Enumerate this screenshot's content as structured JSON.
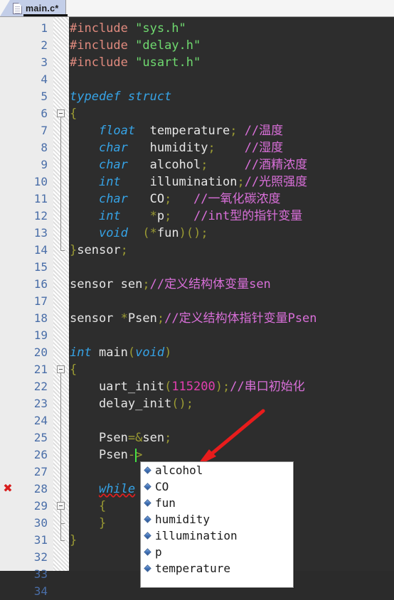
{
  "window": {
    "tab": {
      "label": "main.c*",
      "icon": "file-icon",
      "modified": true
    }
  },
  "editor": {
    "line_numbers": [
      1,
      2,
      3,
      4,
      5,
      6,
      7,
      8,
      9,
      10,
      11,
      12,
      13,
      14,
      15,
      16,
      17,
      18,
      19,
      20,
      21,
      22,
      23,
      24,
      25,
      26,
      27,
      28,
      29,
      30,
      31,
      32,
      33,
      34
    ],
    "colors": {
      "background": "#2d2d2d",
      "gutter_background": "#ececec",
      "line_number": "#4a6ea8",
      "preprocessor": "#e08a7e",
      "string": "#6fd96f",
      "keyword": "#36a3e6",
      "comment": "#d96fd9",
      "number": "#e33fb0",
      "punctuation": "#9a9a33",
      "plain_text": "#e6e6e6",
      "caret": "#44e044",
      "error_marker": "#d81d1d",
      "annotation_arrow": "#e81c1c",
      "tab_active": "#c3cee8"
    },
    "lines": [
      {
        "n": 1,
        "tokens": [
          {
            "t": "#include ",
            "c": "pre"
          },
          {
            "t": "\"sys.h\"",
            "c": "str"
          }
        ]
      },
      {
        "n": 2,
        "tokens": [
          {
            "t": "#include ",
            "c": "pre"
          },
          {
            "t": "\"delay.h\"",
            "c": "str"
          }
        ]
      },
      {
        "n": 3,
        "tokens": [
          {
            "t": "#include ",
            "c": "pre"
          },
          {
            "t": "\"usart.h\"",
            "c": "str"
          }
        ]
      },
      {
        "n": 4,
        "tokens": []
      },
      {
        "n": 5,
        "tokens": [
          {
            "t": "typedef struct",
            "c": "kw"
          }
        ]
      },
      {
        "n": 6,
        "tokens": [
          {
            "t": "{",
            "c": "punct"
          }
        ]
      },
      {
        "n": 7,
        "tokens": [
          {
            "t": "    ",
            "c": "plain"
          },
          {
            "t": "float",
            "c": "kw"
          },
          {
            "t": "  temperature",
            "c": "plain"
          },
          {
            "t": ";",
            "c": "punct"
          },
          {
            "t": " //温度",
            "c": "cmt"
          }
        ]
      },
      {
        "n": 8,
        "tokens": [
          {
            "t": "    ",
            "c": "plain"
          },
          {
            "t": "char",
            "c": "kw"
          },
          {
            "t": "   humidity",
            "c": "plain"
          },
          {
            "t": ";",
            "c": "punct"
          },
          {
            "t": "    //湿度",
            "c": "cmt"
          }
        ]
      },
      {
        "n": 9,
        "tokens": [
          {
            "t": "    ",
            "c": "plain"
          },
          {
            "t": "char",
            "c": "kw"
          },
          {
            "t": "   alcohol",
            "c": "plain"
          },
          {
            "t": ";",
            "c": "punct"
          },
          {
            "t": "     //酒精浓度",
            "c": "cmt"
          }
        ]
      },
      {
        "n": 10,
        "tokens": [
          {
            "t": "    ",
            "c": "plain"
          },
          {
            "t": "int",
            "c": "kw"
          },
          {
            "t": "    illumination",
            "c": "plain"
          },
          {
            "t": ";",
            "c": "punct"
          },
          {
            "t": "//光照强度",
            "c": "cmt"
          }
        ]
      },
      {
        "n": 11,
        "tokens": [
          {
            "t": "    ",
            "c": "plain"
          },
          {
            "t": "char",
            "c": "kw"
          },
          {
            "t": "   CO",
            "c": "plain"
          },
          {
            "t": ";",
            "c": "punct"
          },
          {
            "t": "   //一氧化碳浓度",
            "c": "cmt"
          }
        ]
      },
      {
        "n": 12,
        "tokens": [
          {
            "t": "    ",
            "c": "plain"
          },
          {
            "t": "int",
            "c": "kw"
          },
          {
            "t": "    ",
            "c": "plain"
          },
          {
            "t": "*",
            "c": "punct"
          },
          {
            "t": "p",
            "c": "plain"
          },
          {
            "t": ";",
            "c": "punct"
          },
          {
            "t": "   //int型的指针变量",
            "c": "cmt"
          }
        ]
      },
      {
        "n": 13,
        "tokens": [
          {
            "t": "    ",
            "c": "plain"
          },
          {
            "t": "void",
            "c": "kw"
          },
          {
            "t": "  ",
            "c": "plain"
          },
          {
            "t": "(",
            "c": "punct"
          },
          {
            "t": "*",
            "c": "punct"
          },
          {
            "t": "fun",
            "c": "plain"
          },
          {
            "t": ")",
            "c": "punct"
          },
          {
            "t": "()",
            "c": "punct"
          },
          {
            "t": ";",
            "c": "punct"
          }
        ]
      },
      {
        "n": 14,
        "tokens": [
          {
            "t": "}",
            "c": "punct"
          },
          {
            "t": "sensor",
            "c": "plain"
          },
          {
            "t": ";",
            "c": "punct"
          }
        ]
      },
      {
        "n": 15,
        "tokens": []
      },
      {
        "n": 16,
        "tokens": [
          {
            "t": "sensor sen",
            "c": "plain"
          },
          {
            "t": ";",
            "c": "punct"
          },
          {
            "t": "//定义结构体变量sen",
            "c": "cmt"
          }
        ]
      },
      {
        "n": 17,
        "tokens": []
      },
      {
        "n": 18,
        "tokens": [
          {
            "t": "sensor ",
            "c": "plain"
          },
          {
            "t": "*",
            "c": "punct"
          },
          {
            "t": "Psen",
            "c": "plain"
          },
          {
            "t": ";",
            "c": "punct"
          },
          {
            "t": "//定义结构体指针变量Psen",
            "c": "cmt"
          }
        ]
      },
      {
        "n": 19,
        "tokens": []
      },
      {
        "n": 20,
        "tokens": [
          {
            "t": "int",
            "c": "kw"
          },
          {
            "t": " main",
            "c": "plain"
          },
          {
            "t": "(",
            "c": "punct"
          },
          {
            "t": "void",
            "c": "kw"
          },
          {
            "t": ")",
            "c": "punct"
          }
        ]
      },
      {
        "n": 21,
        "tokens": [
          {
            "t": "{",
            "c": "punct"
          }
        ]
      },
      {
        "n": 22,
        "tokens": [
          {
            "t": "    uart_init",
            "c": "plain"
          },
          {
            "t": "(",
            "c": "punct"
          },
          {
            "t": "115200",
            "c": "num"
          },
          {
            "t": ")",
            "c": "punct"
          },
          {
            "t": ";",
            "c": "punct"
          },
          {
            "t": "//串口初始化",
            "c": "cmt"
          }
        ]
      },
      {
        "n": 23,
        "tokens": [
          {
            "t": "    delay_init",
            "c": "plain"
          },
          {
            "t": "()",
            "c": "punct"
          },
          {
            "t": ";",
            "c": "punct"
          }
        ]
      },
      {
        "n": 24,
        "tokens": []
      },
      {
        "n": 25,
        "tokens": [
          {
            "t": "    Psen",
            "c": "plain"
          },
          {
            "t": "=",
            "c": "punct"
          },
          {
            "t": "&",
            "c": "punct"
          },
          {
            "t": "sen",
            "c": "plain"
          },
          {
            "t": ";",
            "c": "punct"
          }
        ]
      },
      {
        "n": 26,
        "tokens": [
          {
            "t": "    Psen",
            "c": "plain"
          },
          {
            "t": "->",
            "c": "punct"
          }
        ]
      },
      {
        "n": 27,
        "tokens": []
      },
      {
        "n": 28,
        "tokens": [
          {
            "t": "    ",
            "c": "plain"
          },
          {
            "t": "while",
            "c": "kw-sq"
          }
        ]
      },
      {
        "n": 29,
        "tokens": [
          {
            "t": "    ",
            "c": "plain"
          },
          {
            "t": "{",
            "c": "punct"
          }
        ]
      },
      {
        "n": 30,
        "tokens": [
          {
            "t": "    ",
            "c": "plain"
          },
          {
            "t": "}",
            "c": "punct"
          }
        ]
      },
      {
        "n": 31,
        "tokens": [
          {
            "t": "}",
            "c": "punct"
          }
        ]
      },
      {
        "n": 32,
        "tokens": []
      },
      {
        "n": 33,
        "tokens": []
      },
      {
        "n": 34,
        "tokens": []
      }
    ],
    "fold_widgets": [
      {
        "line": 6,
        "type": "collapse",
        "span_to": 14
      },
      {
        "line": 21,
        "type": "collapse",
        "span_to": 31
      },
      {
        "line": 29,
        "type": "collapse",
        "span_to": 30
      }
    ],
    "error_markers": [
      {
        "line": 28,
        "icon": "error-x-icon"
      }
    ],
    "caret": {
      "line": 26,
      "column": 9
    }
  },
  "autocomplete": {
    "visible": true,
    "items": [
      {
        "label": "alcohol",
        "icon": "member-cube-icon"
      },
      {
        "label": "CO",
        "icon": "member-cube-icon"
      },
      {
        "label": "fun",
        "icon": "member-cube-icon"
      },
      {
        "label": "humidity",
        "icon": "member-cube-icon"
      },
      {
        "label": "illumination",
        "icon": "member-cube-icon"
      },
      {
        "label": "p",
        "icon": "member-cube-icon"
      },
      {
        "label": "temperature",
        "icon": "member-cube-icon"
      }
    ]
  },
  "annotation": {
    "arrow": {
      "color": "#e81c1c",
      "points_to": "caret-after-arrow-operator"
    }
  }
}
